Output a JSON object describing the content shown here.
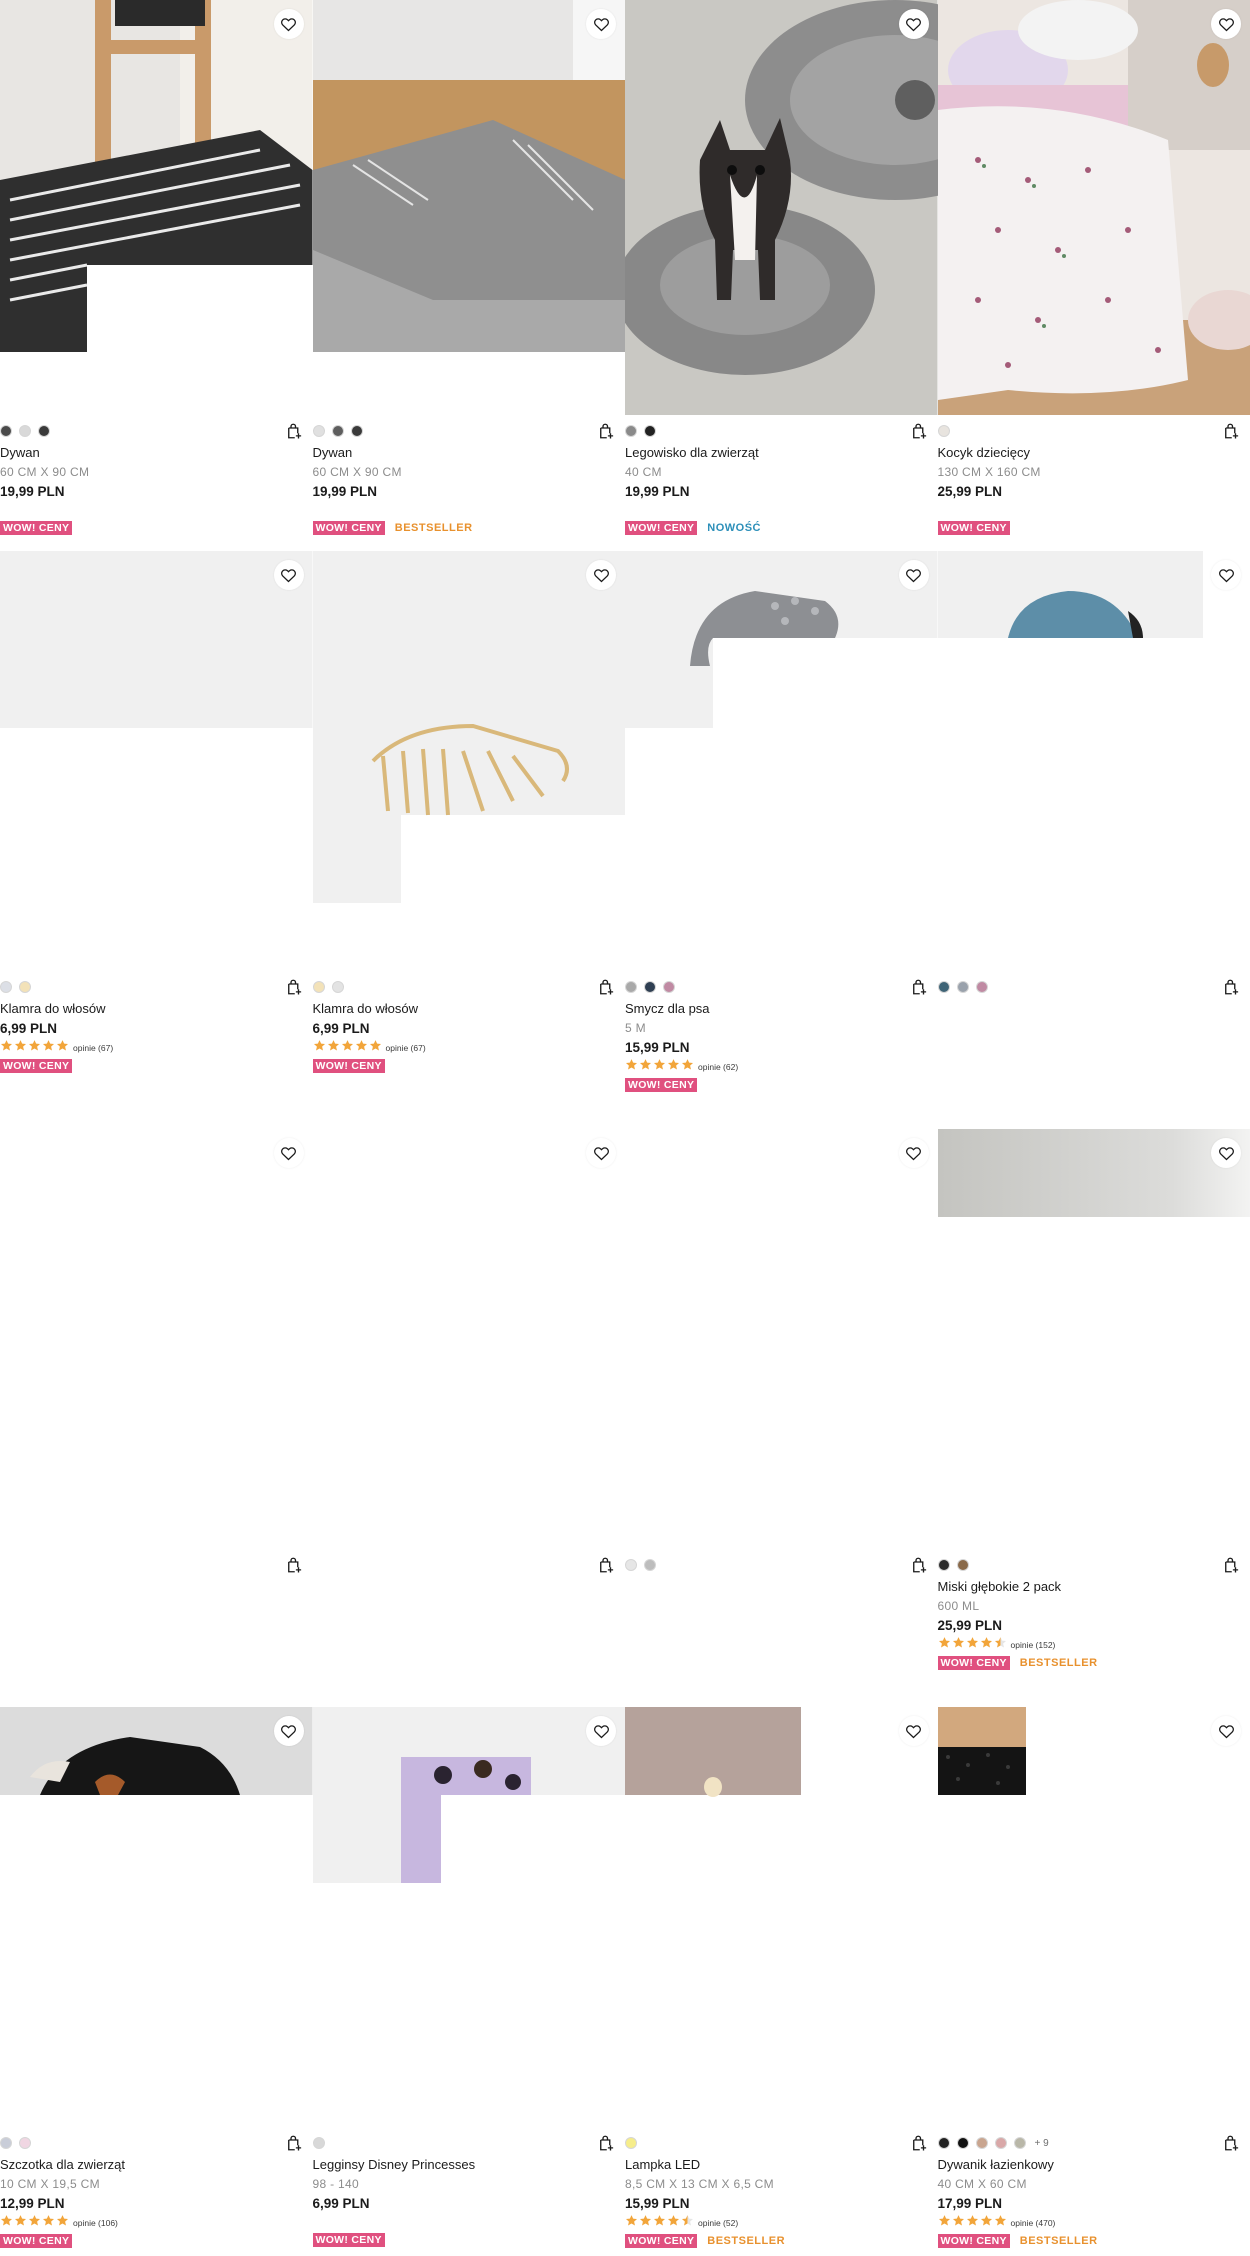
{
  "colors": {
    "wow_badge": "#e0507f",
    "bestseller": "#e8912e",
    "new": "#2c8fb9",
    "star": "#f2a53a"
  },
  "icons": {
    "wishlist": "heart-outline-icon",
    "add_to_cart": "shopping-bag-plus-icon",
    "rating": "star-icon"
  },
  "products": [
    {
      "name": "Dywan",
      "size": "60 CM X 90 CM",
      "price": "19,99 PLN",
      "wow": "WOW! CENY",
      "tag": "",
      "tag_type": "",
      "swatches": [
        "#4a4a4a",
        "#d9d9d9",
        "#3a3a3a"
      ],
      "more": "",
      "rating": null,
      "reviews": "",
      "image": "rug-dark-striped"
    },
    {
      "name": "Dywan",
      "size": "60 CM X 90 CM",
      "price": "19,99 PLN",
      "wow": "WOW! CENY",
      "tag": "BESTSELLER",
      "tag_type": "best",
      "swatches": [
        "#e0e0e0",
        "#5e5e5e",
        "#3a3a3a"
      ],
      "more": "",
      "rating": null,
      "reviews": "",
      "image": "rug-grey"
    },
    {
      "name": "Legowisko dla zwierząt",
      "size": "40 CM",
      "price": "19,99 PLN",
      "wow": "WOW! CENY",
      "tag": "NOWOŚĆ",
      "tag_type": "new",
      "swatches": [
        "#8a8a8a",
        "#222222"
      ],
      "more": "",
      "rating": null,
      "reviews": "",
      "image": "pet-bed-dog"
    },
    {
      "name": "Kocyk dziecięcy",
      "size": "130 CM X 160 CM",
      "price": "25,99 PLN",
      "wow": "WOW! CENY",
      "tag": "",
      "tag_type": "",
      "swatches": [
        "#e8e4df"
      ],
      "more": "",
      "rating": null,
      "reviews": "",
      "image": "kids-blanket"
    },
    {
      "name": "Klamra do włosów",
      "size": "",
      "price": "6,99 PLN",
      "wow": "WOW! CENY",
      "tag": "",
      "tag_type": "",
      "swatches": [
        "#dcdfe6",
        "#f3e2b8"
      ],
      "more": "",
      "rating": 5,
      "reviews": "opinie (67)",
      "image": "hair-clip"
    },
    {
      "name": "Klamra do włosów",
      "size": "",
      "price": "6,99 PLN",
      "wow": "WOW! CENY",
      "tag": "",
      "tag_type": "",
      "swatches": [
        "#f3e2b8",
        "#e3e3e3"
      ],
      "more": "",
      "rating": 5,
      "reviews": "opinie (67)",
      "image": "hair-clip-gold"
    },
    {
      "name": "Smycz dla psa",
      "size": "5 M",
      "price": "15,99 PLN",
      "wow": "WOW! CENY",
      "tag": "",
      "tag_type": "",
      "swatches": [
        "#a9a9a9",
        "#2f3f52",
        "#c08aa3"
      ],
      "more": "",
      "rating": 5,
      "reviews": "opinie (62)",
      "image": "dog-leash-grey"
    },
    {
      "name": "",
      "size": "",
      "price": "",
      "wow": "",
      "tag": "",
      "tag_type": "",
      "swatches": [
        "#3f6476",
        "#9aa2ac",
        "#c08aa3"
      ],
      "more": "",
      "rating": null,
      "reviews": "",
      "image": "dog-leash-blue"
    },
    {
      "name": "",
      "size": "",
      "price": "",
      "wow": "",
      "tag": "",
      "tag_type": "",
      "swatches": [],
      "more": "",
      "rating": null,
      "reviews": "",
      "image": "blank"
    },
    {
      "name": "",
      "size": "",
      "price": "",
      "wow": "",
      "tag": "",
      "tag_type": "",
      "swatches": [],
      "more": "",
      "rating": null,
      "reviews": "",
      "image": "blank"
    },
    {
      "name": "",
      "size": "",
      "price": "",
      "wow": "",
      "tag": "",
      "tag_type": "",
      "swatches": [
        "#e6e6e6",
        "#bdbdbd"
      ],
      "more": "",
      "rating": null,
      "reviews": "",
      "image": "blank"
    },
    {
      "name": "Miski głębokie 2 pack",
      "size": "600 ML",
      "price": "25,99 PLN",
      "wow": "WOW! CENY",
      "tag": "BESTSELLER",
      "tag_type": "best",
      "swatches": [
        "#2b2b2b",
        "#8a6a4a"
      ],
      "more": "",
      "rating": 4.5,
      "reviews": "opinie (152)",
      "image": "bowls-wall"
    },
    {
      "name": "Szczotka dla zwierząt",
      "size": "10 CM X 19,5 CM",
      "price": "12,99 PLN",
      "wow": "WOW! CENY",
      "tag": "",
      "tag_type": "",
      "swatches": [
        "#c9cdd8",
        "#f0d6e2"
      ],
      "more": "",
      "rating": 5,
      "reviews": "opinie (106)",
      "image": "dog-brush"
    },
    {
      "name": "Legginsy Disney Princesses",
      "size": "98 - 140",
      "price": "6,99 PLN",
      "wow": "WOW! CENY",
      "tag": "",
      "tag_type": "",
      "swatches": [
        "#d8d8d8"
      ],
      "more": "",
      "rating": null,
      "reviews": "",
      "image": "leggings-lilac"
    },
    {
      "name": "Lampka LED",
      "size": "8,5 CM X 13 CM X 6,5 CM",
      "price": "15,99 PLN",
      "wow": "WOW! CENY",
      "tag": "BESTSELLER",
      "tag_type": "best",
      "swatches": [
        "#f6ed8a"
      ],
      "more": "",
      "rating": 4.5,
      "reviews": "opinie (52)",
      "image": "led-lamp"
    },
    {
      "name": "Dywanik łazienkowy",
      "size": "40 CM X 60 CM",
      "price": "17,99 PLN",
      "wow": "WOW! CENY",
      "tag": "BESTSELLER",
      "tag_type": "best",
      "swatches": [
        "#222222",
        "#111111",
        "#c9a58f",
        "#d9a8a8",
        "#b9b7a8"
      ],
      "more": "+ 9",
      "rating": 5,
      "reviews": "opinie (470)",
      "image": "bath-mat"
    }
  ]
}
